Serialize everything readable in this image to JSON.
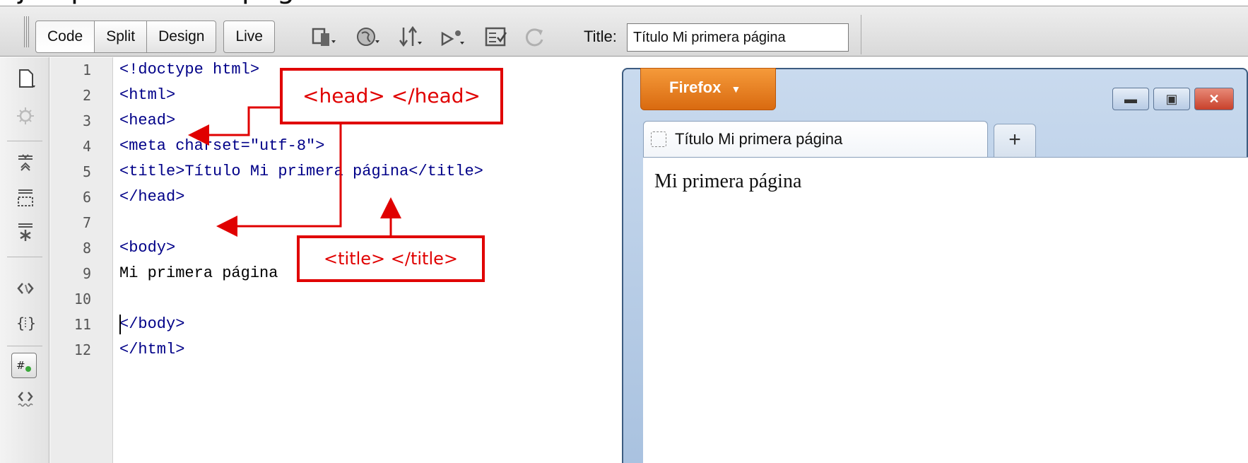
{
  "heading": {
    "text": "Ejemplo Primera página"
  },
  "toolbar": {
    "buttons": [
      "Code",
      "Split",
      "Design",
      "Live"
    ],
    "title_label": "Title:",
    "title_value": "Título Mi primera página",
    "icons": [
      "multiscreen-icon",
      "preview-globe-icon",
      "file-transfer-icon",
      "debug-icon",
      "validate-icon",
      "refresh-icon"
    ]
  },
  "gutter_icons": [
    "open-documents-icon",
    "show-code-navigator-icon",
    "collapse-full-tag-icon",
    "collapse-selection-icon",
    "expand-all-icon",
    "select-parent-tag-icon",
    "balance-braces-icon",
    "line-numbers-icon",
    "syntax-error-icon"
  ],
  "editor": {
    "line_numbers": [
      "1",
      "2",
      "3",
      "4",
      "5",
      "6",
      "7",
      "8",
      "9",
      "10",
      "11",
      "12"
    ],
    "lines": [
      "<!doctype html>",
      "<html>",
      "<head>",
      "<meta charset=\"utf-8\">",
      "<title>Título Mi primera página</title>",
      "</head>",
      "",
      "<body>",
      "Mi primera página",
      "",
      "</body>",
      "</html>"
    ]
  },
  "browser": {
    "menu_button": "Firefox",
    "tab_title": "Título Mi primera página",
    "new_tab": "+",
    "page_text": "Mi primera página",
    "window_controls": [
      "minimize",
      "maximize",
      "close"
    ]
  },
  "annotations": {
    "head_label": "<head> </head>",
    "title_label": "<title> </title>",
    "color": "#e00000"
  }
}
